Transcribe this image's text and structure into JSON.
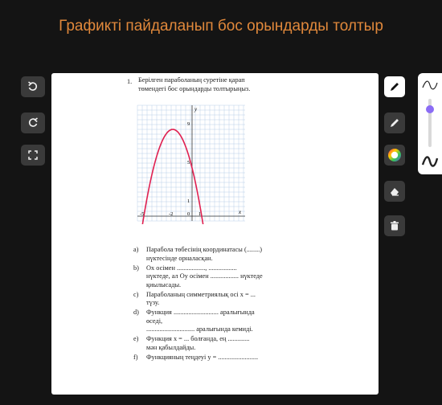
{
  "page": {
    "title": "Графикті пайдаланып бос орындарды толтыр"
  },
  "left_toolbar": {
    "undo_icon": "undo-icon",
    "redo_icon": "redo-icon",
    "fullscreen_icon": "fullscreen-icon"
  },
  "right_toolbar": {
    "tools": [
      "pen-icon",
      "marker-icon",
      "color-wheel-icon",
      "eraser-icon",
      "trash-icon"
    ],
    "active_tool": "pen-icon"
  },
  "thickness_slider": {
    "min_icon": "thin-stroke-icon",
    "max_icon": "thick-stroke-icon",
    "value_fraction": 0.15,
    "accent": "#8b6cf5"
  },
  "document": {
    "question_number": "1.",
    "question_line1": "Берілген параболаның суретіне қарап",
    "question_line2": "төмендегі бос орындарды толтырыңыз.",
    "graph": {
      "y_axis_label": "y",
      "x_axis_label": "x",
      "tick_labels": {
        "y9": "9",
        "y5": "5",
        "y1": "1",
        "xneg5": "-5",
        "xneg2": "-2",
        "origin": "0",
        "x1": "1"
      },
      "curve_color": "#e02050"
    },
    "items": [
      {
        "letter": "a)",
        "lines": [
          "Парабола төбесінің координатасы (........)",
          "нүктесінде орналасқан."
        ]
      },
      {
        "letter": "b)",
        "lines": [
          "Ox осімен ................., .................",
          "нүктеде, ал Oy осімен ................. нүктеде",
          "қиылысады."
        ]
      },
      {
        "letter": "c)",
        "lines": [
          "Параболаның симметриялық осі  x = ...",
          "түзу."
        ]
      },
      {
        "letter": "d)",
        "lines": [
          "Функция ........................... аралығында",
          "өседі,",
          "............................. аралығында кемиді."
        ]
      },
      {
        "letter": "e)",
        "lines": [
          "Функция  x = ... болғанда, ең .............",
          "мән қабылдайды."
        ]
      },
      {
        "letter": "f)",
        "lines": [
          "Функцияның теңдеуі  y = ........................"
        ]
      }
    ]
  }
}
